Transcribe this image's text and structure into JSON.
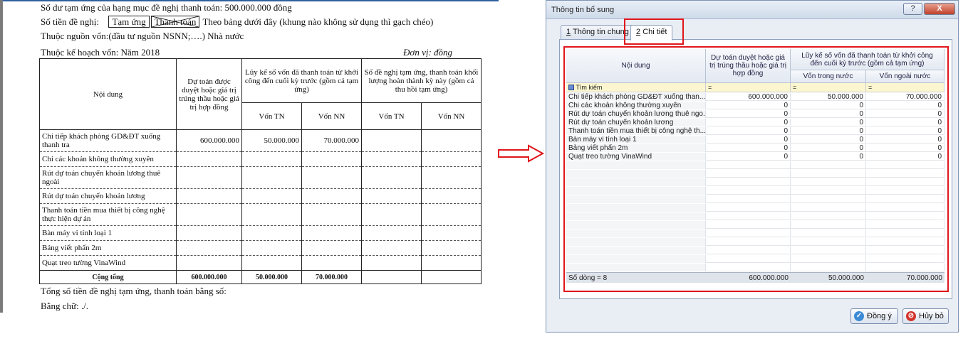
{
  "document": {
    "line1": "Số dư tạm ứng của hạng mục đề nghị thanh toán: 500.000.000 đồng",
    "line2_prefix": "Số tiền đề nghị:",
    "option_advance": "Tạm ứng",
    "option_payment": "Thanh toán",
    "line2_suffix": "Theo bảng dưới đây (khung nào không sử dụng thì gạch chéo)",
    "line3": "Thuộc nguồn vốn:(đầu tư nguồn NSNN;….) Nhà nước",
    "line4": "Thuộc kế hoạch vốn: Năm 2018",
    "unit": "Đơn vị: đồng",
    "table": {
      "h_content": "Nội dung",
      "h_estimate": "Dự toán được duyệt hoặc giá trị trúng thầu hoặc giá trị hợp đồng",
      "h_cumulative": "Lũy kế số vốn đã thanh toán từ khởi công đến cuối kỳ trước (gồm cả tạm ứng)",
      "h_request": "Số đề nghị tạm ứng, thanh toán khối lượng hoàn thành kỳ này (gồm cả thu hồi tạm ứng)",
      "h_ds_tn": "Vốn TN",
      "h_ds_nn": "Vốn NN",
      "h_rq_tn": "Vốn TN",
      "h_rq_nn": "Vốn NN",
      "rows": [
        {
          "content": "Chi tiếp khách phòng GD&ĐT xuống thanh tra",
          "estimate": "600.000.000",
          "tn": "50.000.000",
          "nn": "70.000.000"
        },
        {
          "content": "Chi các khoản không thường xuyên",
          "estimate": "",
          "tn": "",
          "nn": ""
        },
        {
          "content": "Rút dự toán chuyển khoản lương thuê ngoài",
          "estimate": "",
          "tn": "",
          "nn": ""
        },
        {
          "content": "Rút dự toán chuyển khoản lương",
          "estimate": "",
          "tn": "",
          "nn": ""
        },
        {
          "content": "Thanh toán tiền mua thiết bị công nghệ thực hiện dự án",
          "estimate": "",
          "tn": "",
          "nn": ""
        },
        {
          "content": "Bàn máy vi tính loại 1",
          "estimate": "",
          "tn": "",
          "nn": ""
        },
        {
          "content": "Bảng viết phấn 2m",
          "estimate": "",
          "tn": "",
          "nn": ""
        },
        {
          "content": "Quạt treo tường VinaWind",
          "estimate": "",
          "tn": "",
          "nn": ""
        }
      ],
      "total_label": "Cộng tổng",
      "total_estimate": "600.000.000",
      "total_tn": "50.000.000",
      "total_nn": "70.000.000"
    },
    "footer1": "Tổng số tiền đề nghị tạm ứng, thanh toán bằng số:",
    "footer2": "Bằng chữ: ./."
  },
  "dialog": {
    "title": "Thông tin bổ sung",
    "help_label": "?",
    "close_label": "X",
    "tabs": [
      {
        "num": "1",
        "label": "Thông tin chung"
      },
      {
        "num": "2",
        "label": "Chi tiết"
      }
    ],
    "grid": {
      "h_content": "Nội dung",
      "h_estimate": "Dự toán duyệt hoặc giá trị trúng thầu hoặc giá trị hợp đồng",
      "h_cumulative": "Lũy kế số vốn đã thanh toán từ khởi công đến cuối kỳ trước (gồm cả tạm ứng)",
      "h_domestic": "Vốn trong nước",
      "h_foreign": "Vốn ngoài nước",
      "filter_label": "Tìm kiếm",
      "filter_op": "=",
      "rows": [
        {
          "content": "Chi tiếp khách phòng GD&ĐT xuống than...",
          "estimate": "600.000.000",
          "domestic": "50.000.000",
          "foreign": "70.000.000"
        },
        {
          "content": "Chi các khoản không thường xuyên",
          "estimate": "0",
          "domestic": "0",
          "foreign": "0"
        },
        {
          "content": "Rút dự toán chuyển khoản lương thuê ngo...",
          "estimate": "0",
          "domestic": "0",
          "foreign": "0"
        },
        {
          "content": "Rút dự toán chuyển khoản lương",
          "estimate": "0",
          "domestic": "0",
          "foreign": "0"
        },
        {
          "content": "Thanh toán tiền mua thiết bị công nghệ th...",
          "estimate": "0",
          "domestic": "0",
          "foreign": "0"
        },
        {
          "content": "Bàn máy vi tính loại 1",
          "estimate": "0",
          "domestic": "0",
          "foreign": "0"
        },
        {
          "content": "Bảng viết phấn 2m",
          "estimate": "0",
          "domestic": "0",
          "foreign": "0"
        },
        {
          "content": "Quạt treo tường VinaWind",
          "estimate": "0",
          "domestic": "0",
          "foreign": "0"
        }
      ],
      "footer_count": "Số dòng = 8",
      "footer_estimate": "600.000.000",
      "footer_domestic": "50.000.000",
      "footer_foreign": "70.000.000"
    },
    "ok_label": "Đồng ý",
    "cancel_label": "Hủy bỏ"
  },
  "colors": {
    "highlight": "#e0161c",
    "arrow": "#e0161c",
    "filter_row": "#fbf6cf"
  }
}
